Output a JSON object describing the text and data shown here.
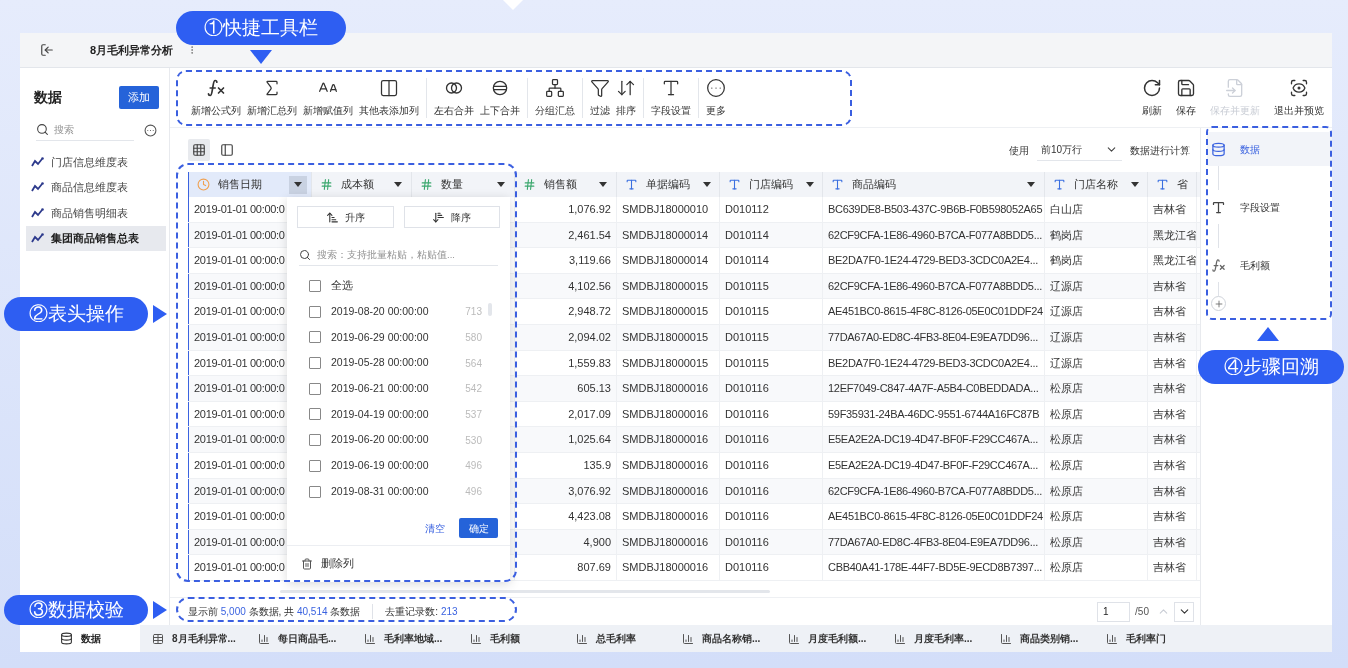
{
  "callouts": [
    {
      "label": "①快捷工具栏"
    },
    {
      "label": "②表头操作"
    },
    {
      "label": "③数据校验"
    },
    {
      "label": "④步骤回溯"
    }
  ],
  "window": {
    "title": "8月毛利异常分析"
  },
  "sidebar": {
    "title": "数据",
    "add_button": "添加",
    "search": {
      "placeholder": "搜索"
    },
    "items": [
      {
        "label": "门店信息维度表",
        "selected": false
      },
      {
        "label": "商品信息维度表",
        "selected": false
      },
      {
        "label": "商品销售明细表",
        "selected": false
      },
      {
        "label": "集团商品销售总表",
        "selected": true
      }
    ]
  },
  "toolbar": {
    "groups": [
      [
        {
          "label": "新增公式列",
          "kind": "formula"
        },
        {
          "label": "新增汇总列",
          "kind": "sum"
        },
        {
          "label": "新增赋值列",
          "kind": "assign"
        },
        {
          "label": "其他表添加列",
          "kind": "add_column"
        }
      ],
      [
        {
          "label": "左右合并",
          "kind": "merge_lr"
        },
        {
          "label": "上下合并",
          "kind": "merge_tb"
        }
      ],
      [
        {
          "label": "分组汇总",
          "kind": "group"
        }
      ],
      [
        {
          "label": "过滤",
          "kind": "filter"
        },
        {
          "label": "排序",
          "kind": "sort"
        }
      ],
      [
        {
          "label": "字段设置",
          "kind": "field"
        }
      ],
      [
        {
          "label": "更多",
          "kind": "more"
        }
      ]
    ],
    "actions": [
      {
        "label": "刷新",
        "kind": "refresh",
        "disabled": false
      },
      {
        "label": "保存",
        "kind": "save",
        "disabled": false
      },
      {
        "label": "保存并更新",
        "kind": "save_update",
        "disabled": true
      },
      {
        "label": "退出并预览",
        "kind": "exit_preview",
        "disabled": false
      }
    ]
  },
  "view_switch": [
    {
      "kind": "grid",
      "selected": true
    },
    {
      "kind": "panel",
      "selected": false
    }
  ],
  "calc": {
    "prefix": "使用",
    "select": "前10万行",
    "suffix": "数据进行计算"
  },
  "table": {
    "columns": [
      {
        "label": "销售日期",
        "kind": "date",
        "selected": true
      },
      {
        "label": "成本额",
        "kind": "number",
        "selected": false
      },
      {
        "label": "数量",
        "kind": "number",
        "selected": false
      },
      {
        "label": "销售额",
        "kind": "number",
        "selected": false
      },
      {
        "label": "单据编码",
        "kind": "text",
        "selected": false
      },
      {
        "label": "门店编码",
        "kind": "text",
        "selected": false
      },
      {
        "label": "商品编码",
        "kind": "text",
        "selected": false
      },
      {
        "label": "门店名称",
        "kind": "text",
        "selected": false
      },
      {
        "label": "省",
        "kind": "text",
        "selected": false
      }
    ],
    "rows": [
      [
        "2019-01-01 00:00:0",
        "",
        "",
        "1,076.92",
        "SMDBJ18000010",
        "D010112",
        "BC639DE8-B503-437C-9B6B-F0B598052A65",
        "白山店",
        "吉林省"
      ],
      [
        "2019-01-01 00:00:0",
        "",
        "",
        "2,461.54",
        "SMDBJ18000014",
        "D010114",
        "62CF9CFA-1E86-4960-B7CA-F077A8BDD5...",
        "鹤岗店",
        "黑龙江省"
      ],
      [
        "2019-01-01 00:00:0",
        "",
        "",
        "3,119.66",
        "SMDBJ18000014",
        "D010114",
        "BE2DA7F0-1E24-4729-BED3-3CDC0A2E4...",
        "鹤岗店",
        "黑龙江省"
      ],
      [
        "2019-01-01 00:00:0",
        "",
        "",
        "4,102.56",
        "SMDBJ18000015",
        "D010115",
        "62CF9CFA-1E86-4960-B7CA-F077A8BDD5...",
        "辽源店",
        "吉林省"
      ],
      [
        "2019-01-01 00:00:0",
        "",
        "",
        "2,948.72",
        "SMDBJ18000015",
        "D010115",
        "AE451BC0-8615-4F8C-8126-05E0C01DDF24",
        "辽源店",
        "吉林省"
      ],
      [
        "2019-01-01 00:00:0",
        "",
        "",
        "2,094.02",
        "SMDBJ18000015",
        "D010115",
        "77DA67A0-ED8C-4FB3-8E04-E9EA7DD96...",
        "辽源店",
        "吉林省"
      ],
      [
        "2019-01-01 00:00:0",
        "",
        "",
        "1,559.83",
        "SMDBJ18000015",
        "D010115",
        "BE2DA7F0-1E24-4729-BED3-3CDC0A2E4...",
        "辽源店",
        "吉林省"
      ],
      [
        "2019-01-01 00:00:0",
        "",
        "",
        "605.13",
        "SMDBJ18000016",
        "D010116",
        "12EF7049-C847-4A7F-A5B4-C0BEDDADA...",
        "松原店",
        "吉林省"
      ],
      [
        "2019-01-01 00:00:0",
        "",
        "",
        "2,017.09",
        "SMDBJ18000016",
        "D010116",
        "59F35931-24BA-46DC-9551-6744A16FC87B",
        "松原店",
        "吉林省"
      ],
      [
        "2019-01-01 00:00:0",
        "",
        "",
        "1,025.64",
        "SMDBJ18000016",
        "D010116",
        "E5EA2E2A-DC19-4D47-BF0F-F29CC467A...",
        "松原店",
        "吉林省"
      ],
      [
        "2019-01-01 00:00:0",
        "",
        "",
        "135.9",
        "SMDBJ18000016",
        "D010116",
        "E5EA2E2A-DC19-4D47-BF0F-F29CC467A...",
        "松原店",
        "吉林省"
      ],
      [
        "2019-01-01 00:00:0",
        "",
        "",
        "3,076.92",
        "SMDBJ18000016",
        "D010116",
        "62CF9CFA-1E86-4960-B7CA-F077A8BDD5...",
        "松原店",
        "吉林省"
      ],
      [
        "2019-01-01 00:00:0",
        "",
        "",
        "4,423.08",
        "SMDBJ18000016",
        "D010116",
        "AE451BC0-8615-4F8C-8126-05E0C01DDF24",
        "松原店",
        "吉林省"
      ],
      [
        "2019-01-01 00:00:0",
        "",
        "",
        "4,900",
        "SMDBJ18000016",
        "D010116",
        "77DA67A0-ED8C-4FB3-8E04-E9EA7DD96...",
        "松原店",
        "吉林省"
      ],
      [
        "2019-01-01 00:00:0",
        "",
        "",
        "807.69",
        "SMDBJ18000016",
        "D010116",
        "CBB40A41-178E-44F7-BD5E-9ECD8B7397...",
        "松原店",
        "吉林省"
      ]
    ]
  },
  "filter_menu": {
    "sort_buttons": [
      {
        "label": "升序",
        "kind": "asc"
      },
      {
        "label": "降序",
        "kind": "desc"
      }
    ],
    "search": {
      "placeholder": "搜索：支持批量粘贴，粘贴值..."
    },
    "select_all": {
      "label": "全选",
      "checked": false
    },
    "options": [
      {
        "label": "2019-08-20 00:00:00",
        "count": "713",
        "checked": false
      },
      {
        "label": "2019-06-29 00:00:00",
        "count": "580",
        "checked": false
      },
      {
        "label": "2019-05-28 00:00:00",
        "count": "564",
        "checked": false
      },
      {
        "label": "2019-06-21 00:00:00",
        "count": "542",
        "checked": false
      },
      {
        "label": "2019-04-19 00:00:00",
        "count": "537",
        "checked": false
      },
      {
        "label": "2019-06-20 00:00:00",
        "count": "530",
        "checked": false
      },
      {
        "label": "2019-06-19 00:00:00",
        "count": "496",
        "checked": false
      },
      {
        "label": "2019-08-31 00:00:00",
        "count": "496",
        "checked": false
      }
    ],
    "clear": "清空",
    "confirm": "确定",
    "delete": "删除列"
  },
  "footer": {
    "shown_prefix": "显示前",
    "shown_count": "5,000",
    "shown_middle": "条数据, 共",
    "total": "40,514",
    "shown_suffix": "条数据",
    "distinct_label": "去重记录数:",
    "distinct_count": "213",
    "page": "1",
    "page_total": "/50"
  },
  "steps": [
    {
      "label": "数据",
      "kind": "data",
      "selected": true
    },
    {
      "label": "字段设置",
      "kind": "field",
      "selected": false
    },
    {
      "label": "毛利额",
      "kind": "formula",
      "selected": false
    }
  ],
  "sheet_tabs": [
    {
      "label": "数据",
      "kind": "data",
      "selected": true
    },
    {
      "label": "8月毛利异常...",
      "kind": "table",
      "selected": false
    },
    {
      "label": "每日商品毛...",
      "kind": "chart",
      "selected": false
    },
    {
      "label": "毛利率地域...",
      "kind": "chart",
      "selected": false
    },
    {
      "label": "毛利额",
      "kind": "chart",
      "selected": false
    },
    {
      "label": "总毛利率",
      "kind": "chart",
      "selected": false
    },
    {
      "label": "商品名称销...",
      "kind": "chart",
      "selected": false
    },
    {
      "label": "月度毛利额...",
      "kind": "chart",
      "selected": false
    },
    {
      "label": "月度毛利率...",
      "kind": "chart",
      "selected": false
    },
    {
      "label": "商品类别销...",
      "kind": "chart",
      "selected": false
    },
    {
      "label": "毛利率门",
      "kind": "chart",
      "selected": false
    }
  ]
}
